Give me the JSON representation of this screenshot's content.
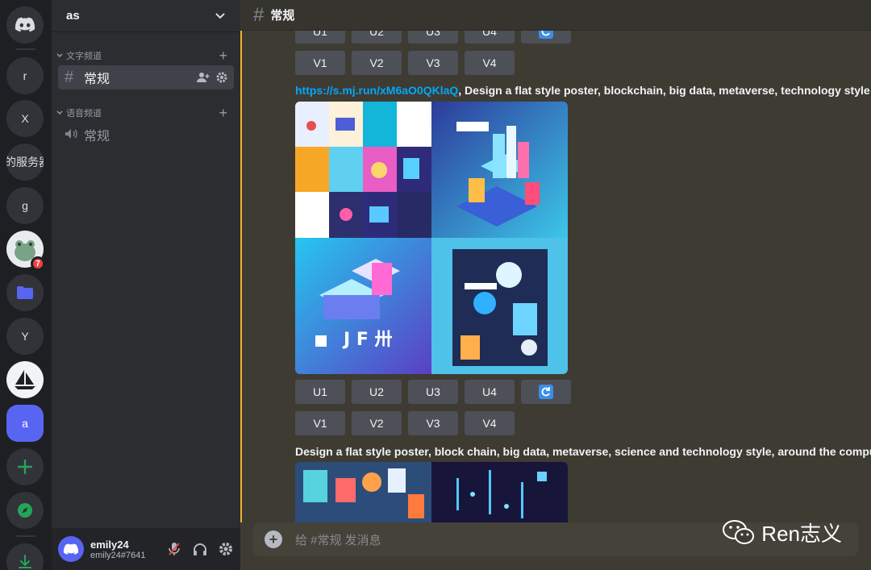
{
  "rail": {
    "servers": [
      {
        "label": "r"
      },
      {
        "label": "X"
      },
      {
        "label": "的服务器"
      },
      {
        "label": "g"
      },
      {
        "label": "Y"
      },
      {
        "label": "a"
      }
    ],
    "badge": "7"
  },
  "sidebar": {
    "guild_name": "as",
    "categories": [
      {
        "label": "文字频道"
      },
      {
        "label": "语音频道"
      }
    ],
    "channels": [
      {
        "label": "常规"
      },
      {
        "label": "常规"
      }
    ]
  },
  "user": {
    "name": "emily24",
    "tag": "emily24#7641"
  },
  "header": {
    "channel": "常规"
  },
  "buttons": {
    "upscale": [
      "U1",
      "U2",
      "U3",
      "U4"
    ],
    "variation": [
      "V1",
      "V2",
      "V3",
      "V4"
    ]
  },
  "messages": {
    "m1_link": "https://s.mj.run/xM6aO0QKlaQ",
    "m1_text": ", Design a flat style poster, blockchain, big data, metaverse, technology style",
    "m2_text": "Design a flat style poster, block chain, big data, metaverse, science and technology style, around the computer"
  },
  "composer": {
    "placeholder": "给 #常规 发消息"
  },
  "watermark": "Ren志义"
}
